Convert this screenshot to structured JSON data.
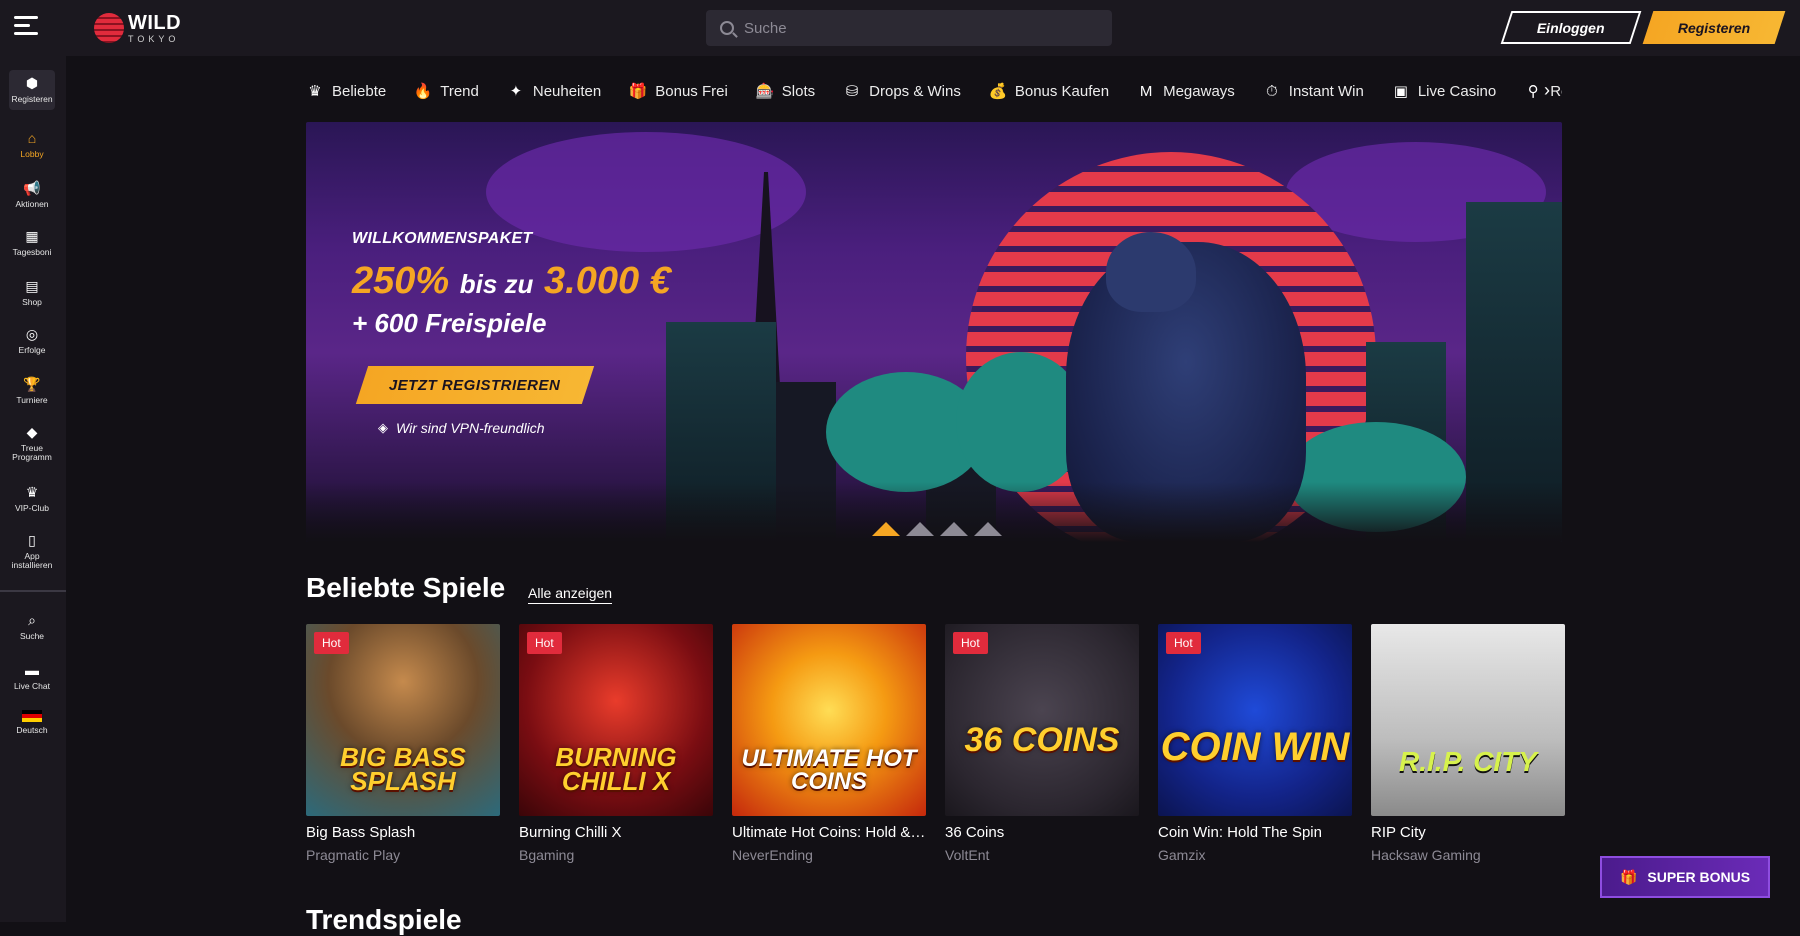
{
  "header": {
    "logo_main": "WILD",
    "logo_sub": "TOKYO",
    "search_placeholder": "Suche",
    "login_label": "Einloggen",
    "register_label": "Registeren"
  },
  "sidebar": {
    "items": [
      {
        "label": "Registeren",
        "icon": "user-icon",
        "glyph": "⬢"
      },
      {
        "label": "Lobby",
        "icon": "home-icon",
        "glyph": "⌂",
        "active": true
      },
      {
        "label": "Aktionen",
        "icon": "megaphone-icon",
        "glyph": "📢"
      },
      {
        "label": "Tagesboni",
        "icon": "calendar-icon",
        "glyph": "▦"
      },
      {
        "label": "Shop",
        "icon": "shop-icon",
        "glyph": "▤"
      },
      {
        "label": "Erfolge",
        "icon": "medal-icon",
        "glyph": "◎"
      },
      {
        "label": "Turniere",
        "icon": "trophy-icon",
        "glyph": "🏆"
      },
      {
        "label": "Treue Programm",
        "icon": "diamond-icon",
        "glyph": "◆"
      },
      {
        "label": "VIP-Club",
        "icon": "crown-icon",
        "glyph": "♛"
      },
      {
        "label": "App installieren",
        "icon": "phone-icon",
        "glyph": "▯"
      },
      {
        "label": "Suche",
        "icon": "search-icon",
        "glyph": "⌕"
      },
      {
        "label": "Live Chat",
        "icon": "chat-icon",
        "glyph": "▬"
      },
      {
        "label": "Deutsch",
        "icon": "flag-de-icon",
        "glyph": "▭"
      }
    ]
  },
  "categories": [
    {
      "label": "Beliebte",
      "icon": "crown-icon",
      "glyph": "♛"
    },
    {
      "label": "Trend",
      "icon": "flame-icon",
      "glyph": "🔥"
    },
    {
      "label": "Neuheiten",
      "icon": "sparkle-icon",
      "glyph": "✦"
    },
    {
      "label": "Bonus Frei",
      "icon": "gift-icon",
      "glyph": "🎁"
    },
    {
      "label": "Slots",
      "icon": "slot-icon",
      "glyph": "🎰"
    },
    {
      "label": "Drops & Wins",
      "icon": "coins-icon",
      "glyph": "⛁"
    },
    {
      "label": "Bonus Kaufen",
      "icon": "moneybag-icon",
      "glyph": "💰"
    },
    {
      "label": "Megaways",
      "icon": "megaways-icon",
      "glyph": "M"
    },
    {
      "label": "Instant Win",
      "icon": "stopwatch-icon",
      "glyph": "⏱"
    },
    {
      "label": "Live Casino",
      "icon": "dealer-icon",
      "glyph": "▣"
    },
    {
      "label": "Roulette",
      "icon": "roulette-icon",
      "glyph": "⚲"
    }
  ],
  "hero": {
    "kicker": "WILLKOMMENSPAKET",
    "percent": "250%",
    "middle": "bis zu",
    "amount": "3.000 €",
    "freespins": "+ 600 Freispiele",
    "cta": "JETZT REGISTRIEREN",
    "vpn": "Wir sind VPN-freundlich"
  },
  "popular": {
    "title": "Beliebte Spiele",
    "show_all": "Alle anzeigen",
    "games": [
      {
        "name": "Big Bass Splash",
        "provider": "Pragmatic Play",
        "hot": true,
        "art": "BIG BASS SPLASH"
      },
      {
        "name": "Burning Chilli X",
        "provider": "Bgaming",
        "hot": true,
        "art": "BURNING CHILLI X"
      },
      {
        "name": "Ultimate Hot Coins: Hold & ...",
        "provider": "NeverEnding",
        "hot": false,
        "art": "ULTIMATE HOT COINS"
      },
      {
        "name": "36 Coins",
        "provider": "VoltEnt",
        "hot": true,
        "art": "36 COINS"
      },
      {
        "name": "Coin Win: Hold The Spin",
        "provider": "Gamzix",
        "hot": true,
        "art": "COIN WIN"
      },
      {
        "name": "RIP City",
        "provider": "Hacksaw Gaming",
        "hot": false,
        "art": "R.I.P. CITY"
      }
    ],
    "hot_label": "Hot"
  },
  "trending": {
    "title": "Trendspiele"
  },
  "super_bonus": {
    "label": "SUPER BONUS"
  }
}
